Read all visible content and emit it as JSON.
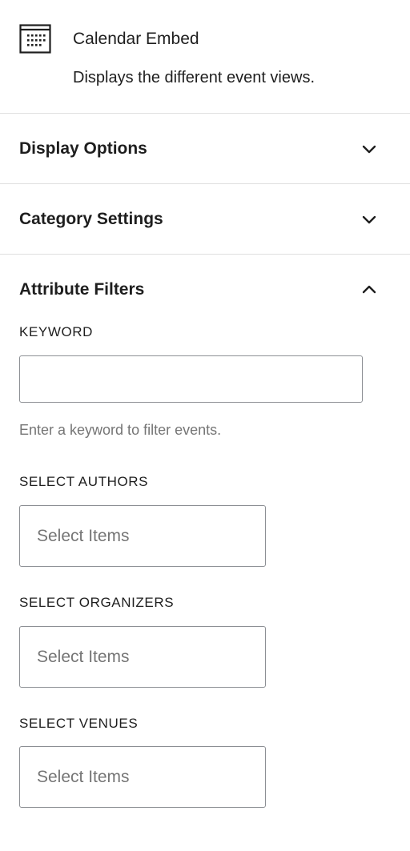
{
  "block": {
    "icon": "calendar-icon",
    "title": "Calendar Embed",
    "description": "Displays the different event views."
  },
  "panels": [
    {
      "title": "Display Options",
      "state": "collapsed",
      "icon": "chevron-down-icon"
    },
    {
      "title": "Category Settings",
      "state": "collapsed",
      "icon": "chevron-down-icon"
    },
    {
      "title": "Attribute Filters",
      "state": "expanded",
      "icon": "chevron-up-icon"
    }
  ],
  "filters": {
    "keyword": {
      "label": "KEYWORD",
      "value": "",
      "help": "Enter a keyword to filter events."
    },
    "authors": {
      "label": "SELECT AUTHORS",
      "placeholder": "Select Items"
    },
    "organizers": {
      "label": "SELECT ORGANIZERS",
      "placeholder": "Select Items"
    },
    "venues": {
      "label": "SELECT VENUES",
      "placeholder": "Select Items"
    }
  },
  "colors": {
    "text": "#1e1e1e",
    "muted": "#757575",
    "border": "#8c8f94",
    "divider": "#e0e0e0"
  }
}
